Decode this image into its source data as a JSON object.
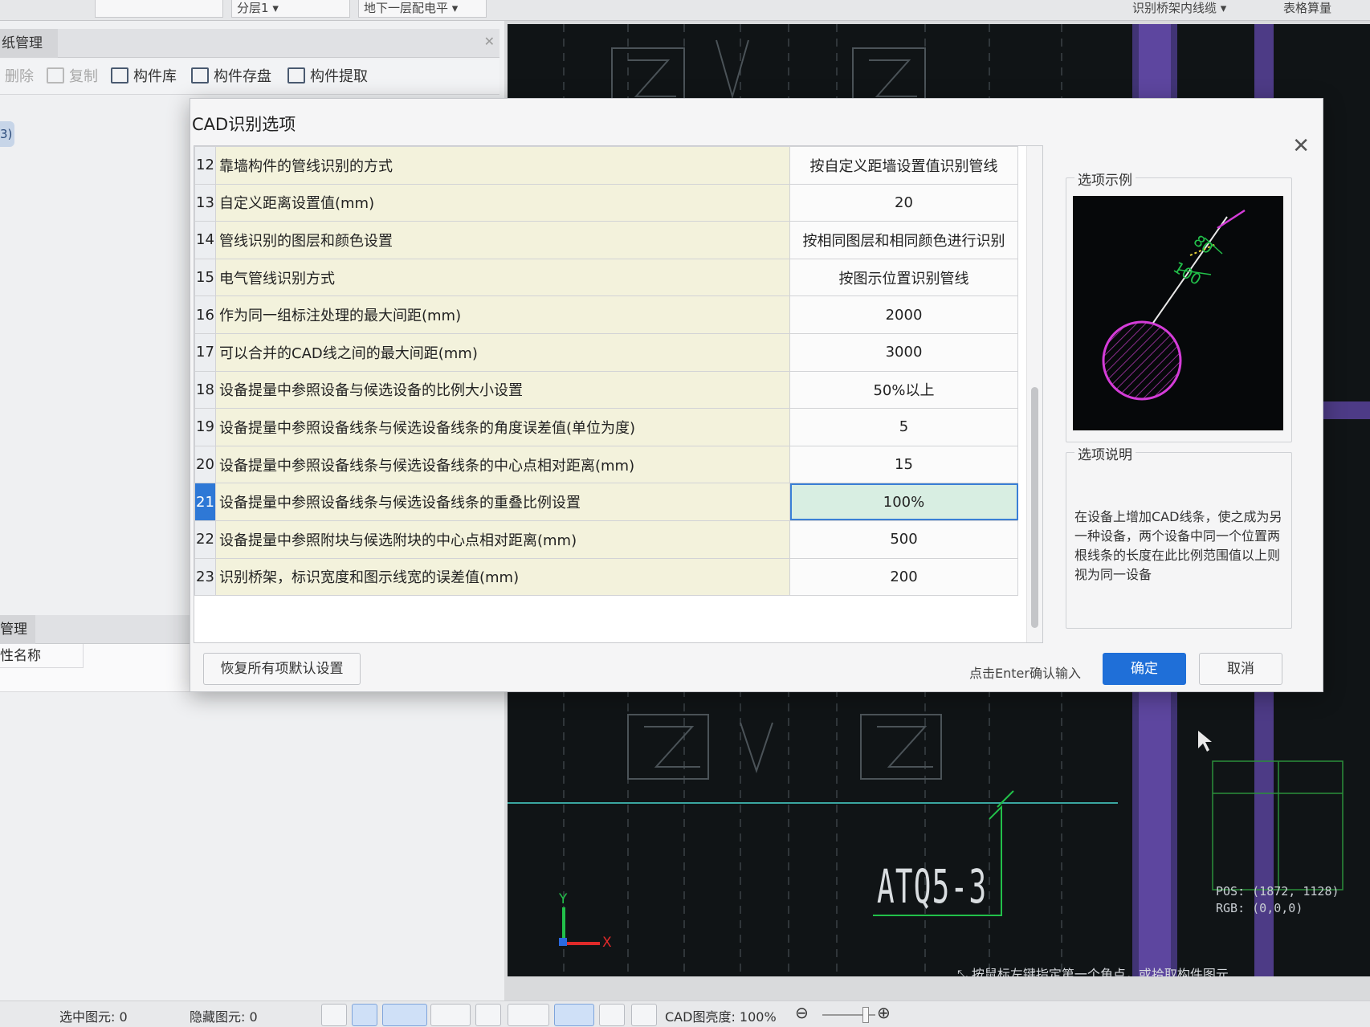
{
  "topbar": {
    "combo1": "",
    "combo2": "分层1",
    "combo3": "地下一层配电平",
    "right_combo": "识别桥架内线缆",
    "right_label": "表格算量"
  },
  "left_panel": {
    "tab": "纸管理",
    "toolbar": [
      {
        "label": "删除",
        "icon": "delete-icon",
        "enabled": false
      },
      {
        "label": "复制",
        "icon": "copy-icon",
        "enabled": false
      },
      {
        "label": "构件库",
        "icon": "component-library-icon",
        "enabled": true
      },
      {
        "label": "构件存盘",
        "icon": "component-save-icon",
        "enabled": true
      },
      {
        "label": "构件提取",
        "icon": "component-extract-icon",
        "enabled": true
      }
    ],
    "tree_tag": "3)",
    "section2_tab": "管理",
    "prop_header": "性名称"
  },
  "dialog": {
    "title": "CAD识别选项",
    "rows": [
      {
        "num": "12",
        "name": "靠墙构件的管线识别的方式",
        "value": "按自定义距墙设置值识别管线"
      },
      {
        "num": "13",
        "name": "自定义距离设置值(mm)",
        "value": "20"
      },
      {
        "num": "14",
        "name": "管线识别的图层和颜色设置",
        "value": "按相同图层和相同颜色进行识别"
      },
      {
        "num": "15",
        "name": "电气管线识别方式",
        "value": "按图示位置识别管线"
      },
      {
        "num": "16",
        "name": "作为同一组标注处理的最大间距(mm)",
        "value": "2000"
      },
      {
        "num": "17",
        "name": "可以合并的CAD线之间的最大间距(mm)",
        "value": "3000"
      },
      {
        "num": "18",
        "name": "设备提量中参照设备与候选设备的比例大小设置",
        "value": "50%以上"
      },
      {
        "num": "19",
        "name": "设备提量中参照设备线条与候选设备线条的角度误差值(单位为度)",
        "value": "5"
      },
      {
        "num": "20",
        "name": "设备提量中参照设备线条与候选设备线条的中心点相对距离(mm)",
        "value": "15"
      },
      {
        "num": "21",
        "name": "设备提量中参照设备线条与候选设备线条的重叠比例设置",
        "value": "100%",
        "selected": true
      },
      {
        "num": "22",
        "name": "设备提量中参照附块与候选附块的中心点相对距离(mm)",
        "value": "500"
      },
      {
        "num": "23",
        "name": "识别桥架，标识宽度和图示线宽的误差值(mm)",
        "value": "200"
      }
    ],
    "example_legend": "选项示例",
    "example_labels": {
      "a": "80",
      "b": "100"
    },
    "desc_legend": "选项说明",
    "desc_text": "在设备上增加CAD线条，使之成为另一种设备，两个设备中同一个位置两根线条的长度在此比例范围值以上则视为同一设备",
    "restore_label": "恢复所有项默认设置",
    "enter_hint": "点击Enter确认输入",
    "ok_label": "确定",
    "cancel_label": "取消"
  },
  "cad": {
    "label": "ATQ5-3",
    "axis_y": "Y",
    "axis_x": "X",
    "pos_label": "POS:",
    "pos_value": "(1872, 1128)",
    "rgb_label": "RGB:",
    "rgb_value": "(0,0,0)",
    "hint": "按鼠标左键指定第一个角点，或拾取构件图元"
  },
  "statusbar": {
    "selected": "选中图元: 0",
    "hidden": "隐藏图元: 0",
    "brightness": "CAD图亮度: 100%"
  },
  "colors": {
    "dialog_primary": "#1f6fd8",
    "name_cell_bg": "#f3f2dc",
    "cad_bg": "#101416",
    "cad_purple": "#6a4fb0",
    "cad_green": "#22c04a",
    "cad_magenta": "#d43cd8"
  }
}
